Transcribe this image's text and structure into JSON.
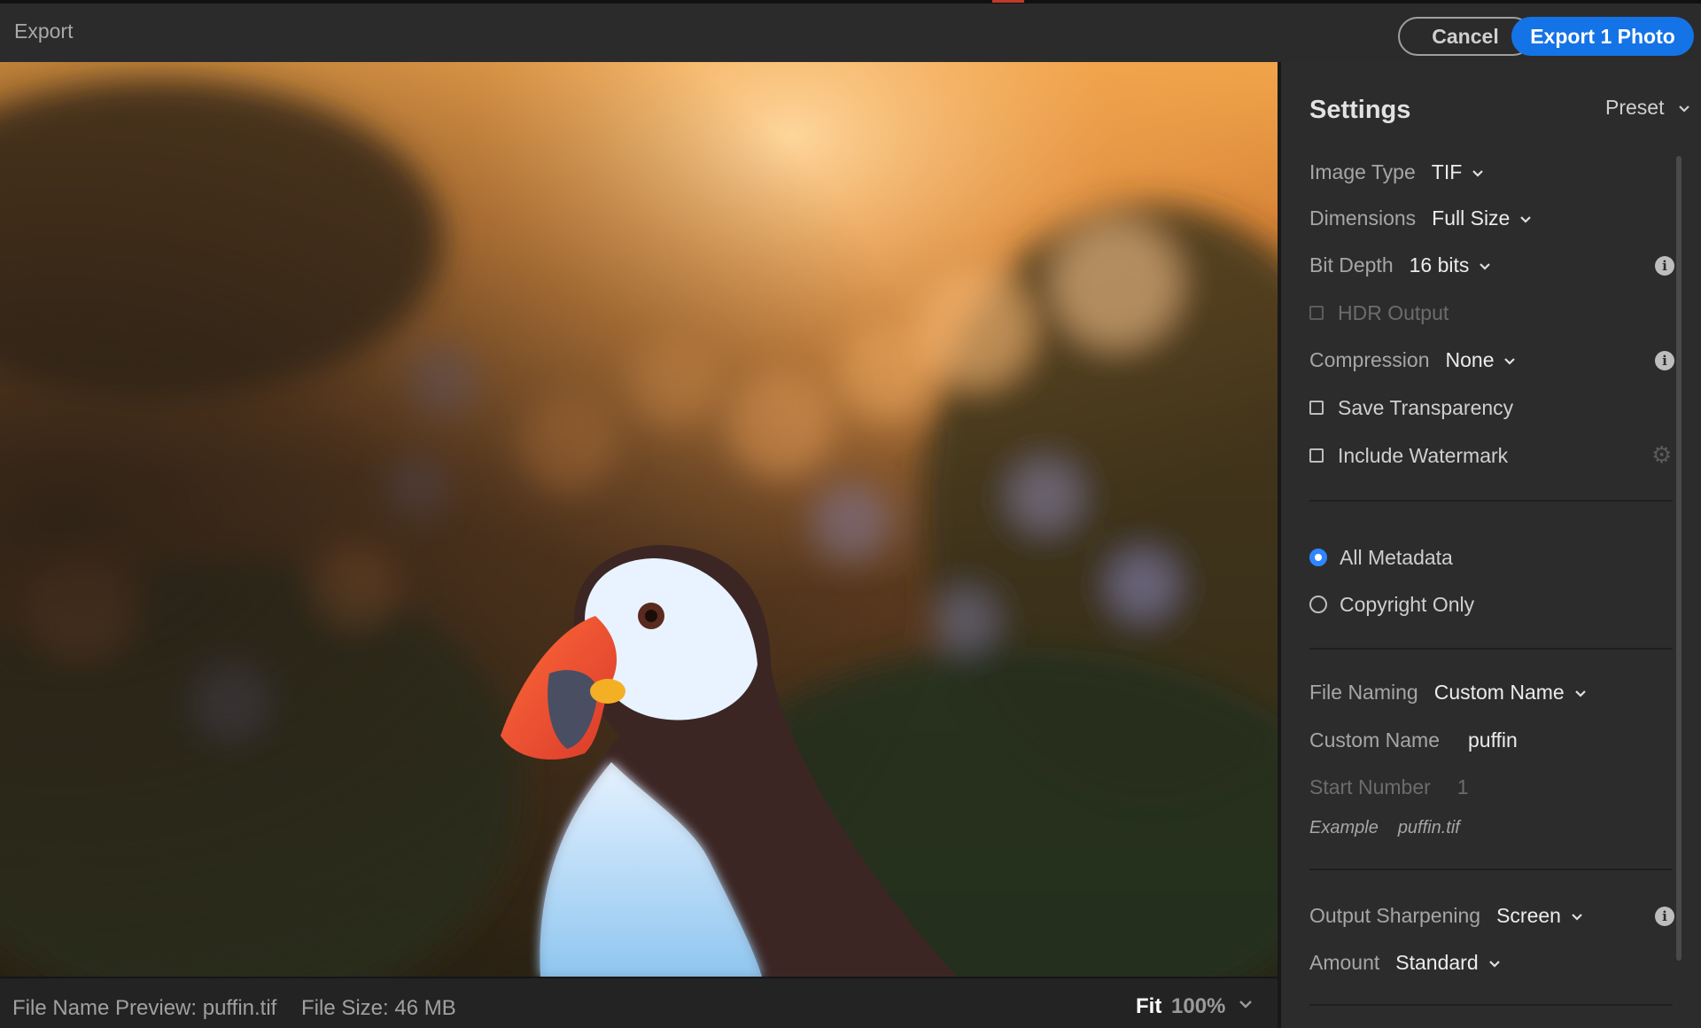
{
  "window": {
    "title": "Export"
  },
  "actions": {
    "cancel": "Cancel",
    "export": "Export 1 Photo"
  },
  "status": {
    "file_name_preview": "File Name Preview: puffin.tif",
    "file_size": "File Size: 46 MB",
    "zoom_fit": "Fit",
    "zoom_percent": "100%"
  },
  "settings": {
    "title": "Settings",
    "preset": "Preset",
    "image_type": {
      "label": "Image Type",
      "value": "TIF"
    },
    "dimensions": {
      "label": "Dimensions",
      "value": "Full Size"
    },
    "bit_depth": {
      "label": "Bit Depth",
      "value": "16 bits"
    },
    "hdr_output": {
      "label": "HDR Output",
      "checked": false,
      "enabled": false
    },
    "compression": {
      "label": "Compression",
      "value": "None"
    },
    "save_transparency": {
      "label": "Save Transparency",
      "checked": false
    },
    "include_watermark": {
      "label": "Include Watermark",
      "checked": false
    },
    "metadata": {
      "options": [
        "All Metadata",
        "Copyright Only"
      ],
      "selected": "All Metadata"
    },
    "file_naming": {
      "label": "File Naming",
      "value": "Custom Name"
    },
    "custom_name": {
      "label": "Custom Name",
      "value": "puffin"
    },
    "start_number": {
      "label": "Start Number",
      "value": "1"
    },
    "example": {
      "label": "Example",
      "value": "puffin.tif"
    },
    "output_sharpening": {
      "label": "Output Sharpening",
      "value": "Screen"
    },
    "amount": {
      "label": "Amount",
      "value": "Standard"
    }
  },
  "colors": {
    "accent": "#1473e6",
    "radio_selected": "#2f86ff",
    "panel_bg": "#2c2c2c"
  },
  "icons": [
    "chevron-down-icon",
    "info-icon",
    "gear-icon",
    "checkbox-icon",
    "radio-icon"
  ]
}
